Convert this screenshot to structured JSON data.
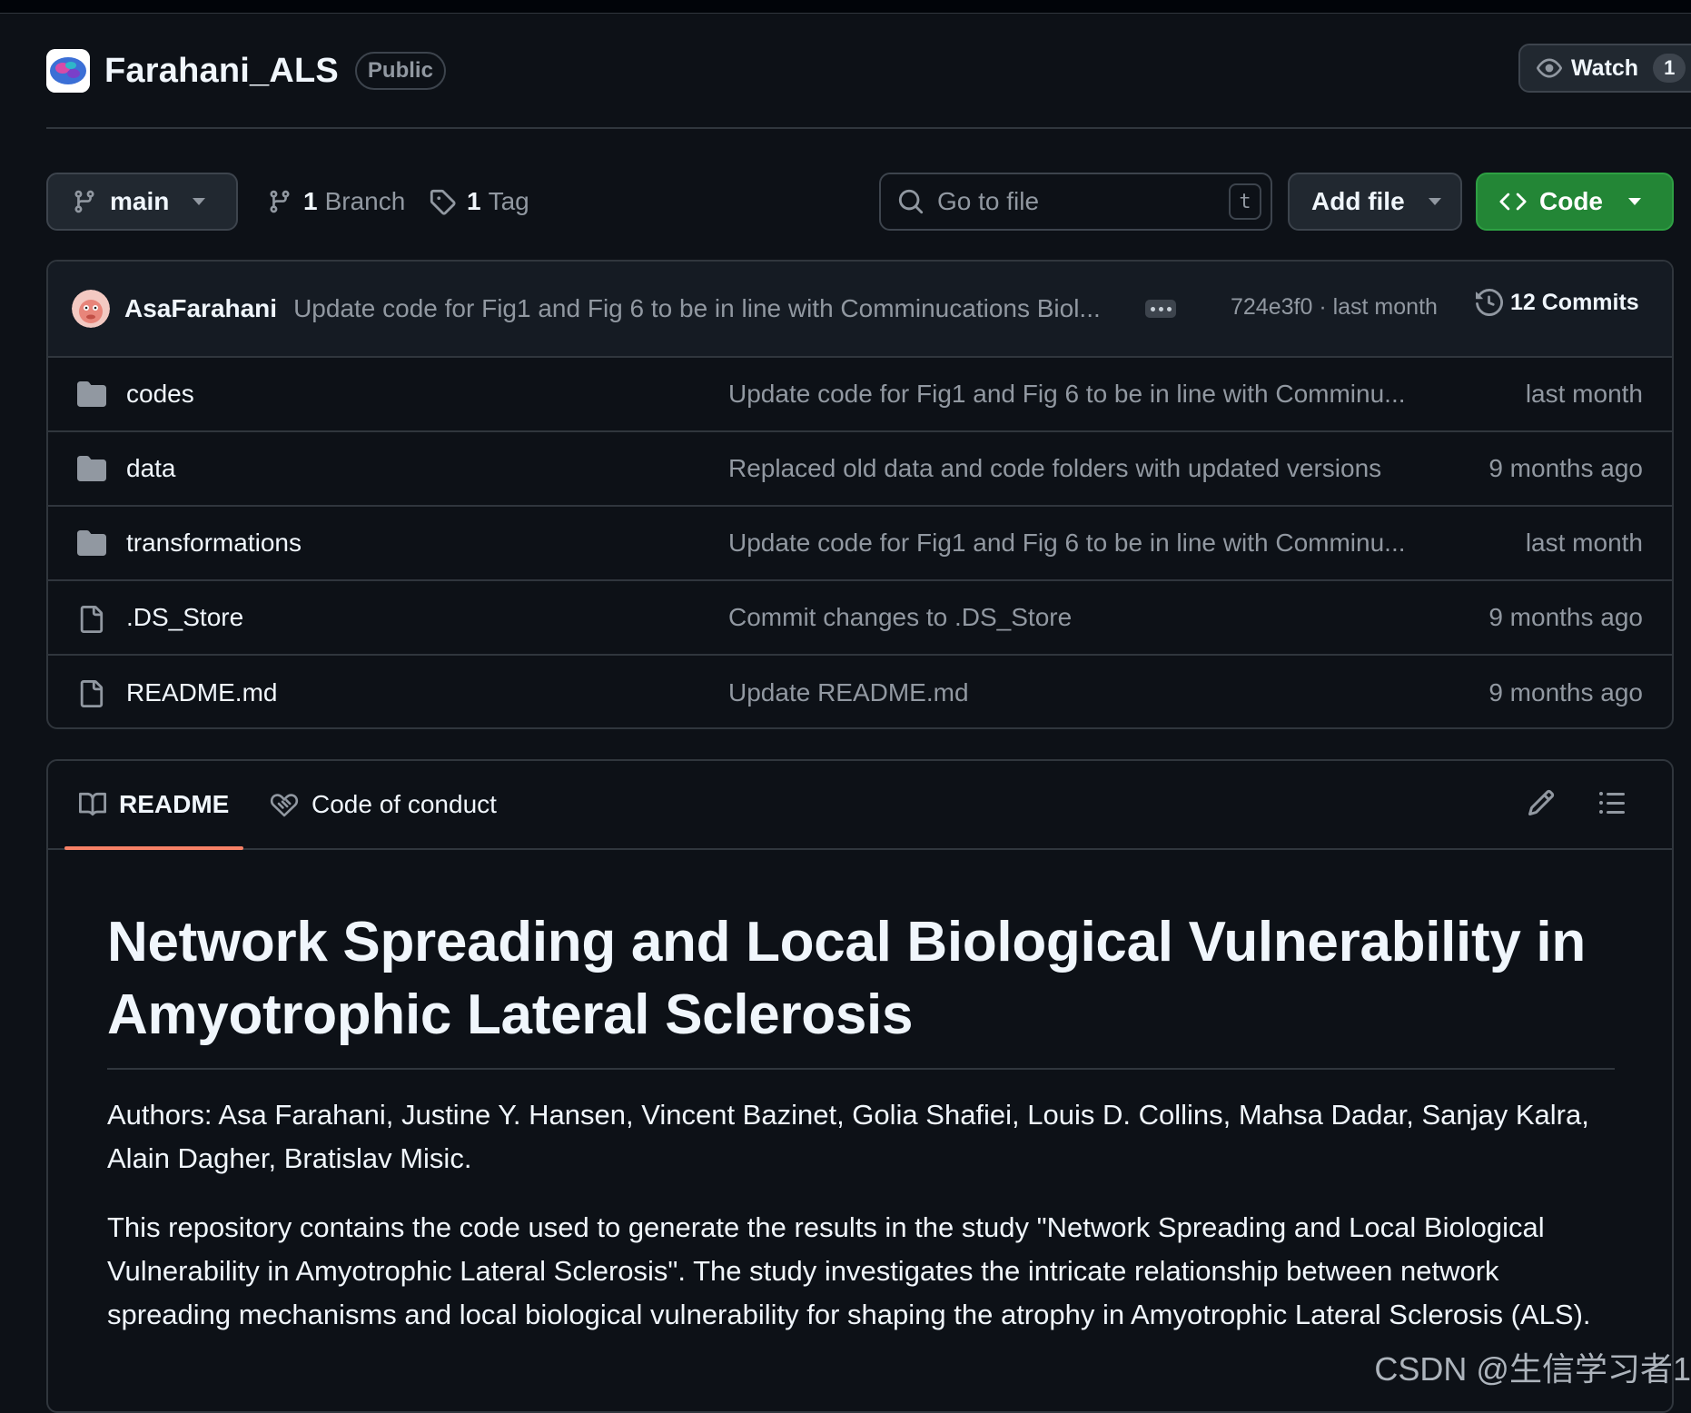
{
  "repo": {
    "name": "Farahani_ALS",
    "visibility": "Public",
    "watch_label": "Watch",
    "watch_count": "1"
  },
  "toolbar": {
    "branch": "main",
    "branches_count": "1",
    "branches_label": "Branch",
    "tags_count": "1",
    "tags_label": "Tag",
    "search_placeholder": "Go to file",
    "search_shortcut": "t",
    "add_file_label": "Add file",
    "code_label": "Code"
  },
  "latest_commit": {
    "author": "AsaFarahani",
    "message": "Update code for Fig1 and Fig 6 to be in line with Comminucations Biol...",
    "sha_time": "724e3f0 · last month",
    "commits_label": "12 Commits"
  },
  "files": [
    {
      "type": "folder",
      "name": "codes",
      "commit": "Update code for Fig1 and Fig 6 to be in line with Comminu...",
      "time": "last month"
    },
    {
      "type": "folder",
      "name": "data",
      "commit": "Replaced old data and code folders with updated versions",
      "time": "9 months ago"
    },
    {
      "type": "folder",
      "name": "transformations",
      "commit": "Update code for Fig1 and Fig 6 to be in line with Comminu...",
      "time": "last month"
    },
    {
      "type": "file",
      "name": ".DS_Store",
      "commit": "Commit changes to .DS_Store",
      "time": "9 months ago"
    },
    {
      "type": "file",
      "name": "README.md",
      "commit": "Update README.md",
      "time": "9 months ago"
    }
  ],
  "readme": {
    "tab_readme": "README",
    "tab_conduct": "Code of conduct",
    "title": "Network Spreading and Local Biological Vulnerability in Amyotrophic Lateral Sclerosis",
    "authors": "Authors: Asa Farahani, Justine Y. Hansen, Vincent Bazinet, Golia Shafiei, Louis D. Collins, Mahsa Dadar, Sanjay Kalra, Alain Dagher, Bratislav Misic.",
    "description": "This repository contains the code used to generate the results in the study \"Network Spreading and Local Biological Vulnerability in Amyotrophic Lateral Sclerosis\". The study investigates the intricate relationship between network spreading mechanisms and local biological vulnerability for shaping the atrophy in Amyotrophic Lateral Sclerosis (ALS)."
  },
  "watermark": "CSDN @生信学习者1",
  "icons": {
    "watch": "eye-icon",
    "branch": "git-branch-icon",
    "tag": "tag-icon",
    "search": "search-icon",
    "code": "code-icon",
    "history": "history-icon",
    "folder": "folder-icon",
    "file": "file-icon",
    "book": "book-icon",
    "conduct": "heart-handshake-icon",
    "edit": "pencil-icon",
    "outline": "list-icon"
  },
  "colors": {
    "background": "#0d1117",
    "border": "#30363d",
    "primary_button": "#238636",
    "tab_underline": "#f78166",
    "muted_text": "#9198a1"
  }
}
